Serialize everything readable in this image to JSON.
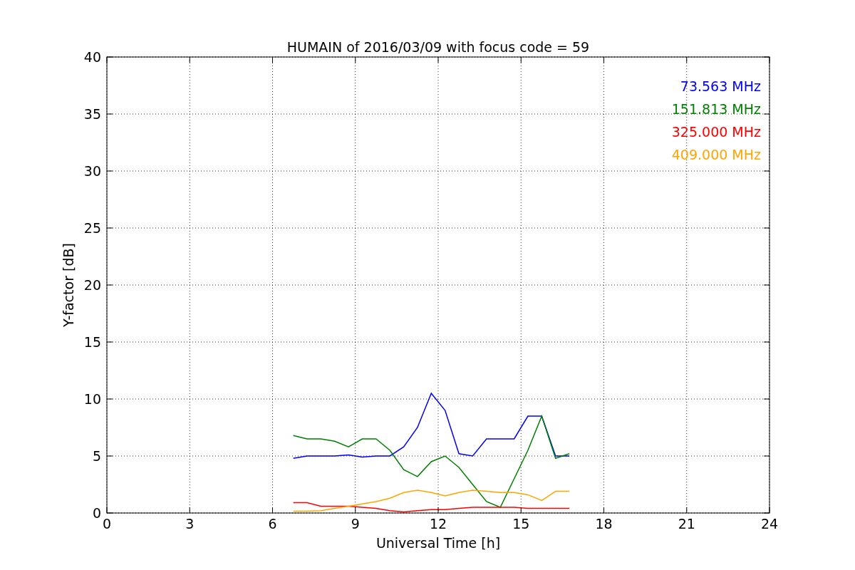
{
  "figure": {
    "chart_data": {
      "type": "line",
      "grid": true,
      "title": "HUMAIN of 2016/03/09 with focus code = 59",
      "xlabel": "Universal Time [h]",
      "ylabel": "Y-factor [dB]",
      "xlim": [
        0,
        24
      ],
      "ylim": [
        0,
        40
      ],
      "xticks": [
        0,
        3,
        6,
        9,
        12,
        15,
        18,
        21,
        24
      ],
      "yticks": [
        0,
        5,
        10,
        15,
        20,
        25,
        30,
        35,
        40
      ],
      "x": [
        6.75,
        7.25,
        7.75,
        8.25,
        8.75,
        9.25,
        9.75,
        10.25,
        10.75,
        11.25,
        11.75,
        12.25,
        12.75,
        13.25,
        13.75,
        14.25,
        14.75,
        15.25,
        15.75,
        16.25,
        16.75
      ],
      "series": [
        {
          "name": "73.563 MHz",
          "color": "#0000ff",
          "values": [
            4.8,
            5.0,
            5.0,
            5.0,
            5.1,
            4.9,
            5.0,
            5.0,
            5.8,
            7.5,
            10.5,
            9.0,
            5.2,
            5.0,
            6.5,
            6.5,
            6.5,
            8.5,
            8.5,
            5.0,
            5.0
          ]
        },
        {
          "name": "151.813 MHz",
          "color": "#008000",
          "values": [
            6.8,
            6.5,
            6.5,
            6.3,
            5.8,
            6.5,
            6.5,
            5.5,
            3.8,
            3.2,
            4.5,
            5.0,
            4.0,
            2.5,
            1.0,
            0.5,
            3.0,
            5.5,
            8.5,
            4.8,
            5.2
          ]
        },
        {
          "name": "325.000 MHz",
          "color": "#ff0000",
          "values": [
            0.9,
            0.9,
            0.6,
            0.6,
            0.6,
            0.5,
            0.4,
            0.2,
            0.1,
            0.2,
            0.3,
            0.3,
            0.4,
            0.5,
            0.5,
            0.5,
            0.5,
            0.4,
            0.4,
            0.4,
            0.4
          ]
        },
        {
          "name": "409.000 MHz",
          "color": "#ffa500",
          "values": [
            0.15,
            0.15,
            0.2,
            0.4,
            0.6,
            0.8,
            1.0,
            1.3,
            1.8,
            2.0,
            1.8,
            1.5,
            1.8,
            2.0,
            1.9,
            1.8,
            1.8,
            1.6,
            1.1,
            1.9,
            1.9
          ]
        }
      ]
    }
  }
}
